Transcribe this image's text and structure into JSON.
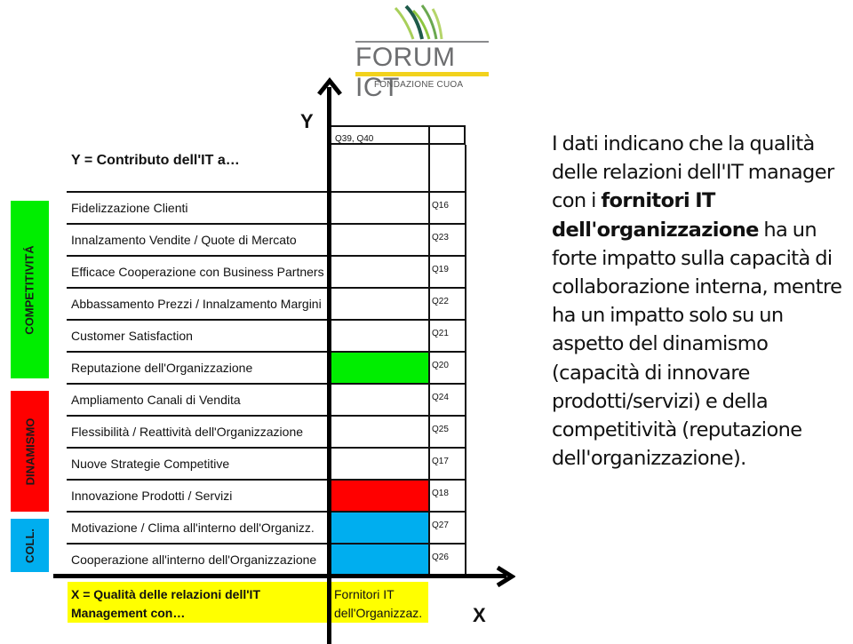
{
  "logo": {
    "name": "FORUM ICT",
    "subtitle": "FONDAZIONE CUOA",
    "colors": {
      "text": "#6d6e70",
      "accent": "#f2d21c",
      "grass_light": "#8dc63f",
      "grass_dark": "#1e5b4a"
    }
  },
  "categories": [
    {
      "label": "COMPETITIVITÁ",
      "color": "#00ee00"
    },
    {
      "label": "DINAMISMO",
      "color": "#ff0000"
    },
    {
      "label": "COLL.",
      "color": "#00aeef"
    }
  ],
  "y_axis": {
    "letter": "Y",
    "title": "Y = Contributo dell'IT a…",
    "top_cell": "Q39, Q40"
  },
  "rows": [
    {
      "label": "Fidelizzazione Clienti",
      "question": "Q16",
      "fill": null
    },
    {
      "label": "Innalzamento Vendite / Quote di Mercato",
      "question": "Q23",
      "fill": null
    },
    {
      "label": "Efficace Cooperazione con Business Partners",
      "question": "Q19",
      "fill": null
    },
    {
      "label": "Abbassamento Prezzi / Innalzamento Margini",
      "question": "Q22",
      "fill": null
    },
    {
      "label": "Customer Satisfaction",
      "question": "Q21",
      "fill": null
    },
    {
      "label": "Reputazione dell'Organizzazione",
      "question": "Q20",
      "fill": "#00ee00"
    },
    {
      "label": "Ampliamento Canali di Vendita",
      "question": "Q24",
      "fill": null
    },
    {
      "label": "Flessibilità / Reattività dell'Organizzazione",
      "question": "Q25",
      "fill": null
    },
    {
      "label": "Nuove Strategie Competitive",
      "question": "Q17",
      "fill": null
    },
    {
      "label": "Innovazione Prodotti / Servizi",
      "question": "Q18",
      "fill": "#ff0000"
    },
    {
      "label": "Motivazione / Clima all'interno dell'Organizz.",
      "question": "Q27",
      "fill": "#00aeef"
    },
    {
      "label": "Cooperazione all'interno dell'Organizzazione",
      "question": "Q26",
      "fill": "#00aeef"
    }
  ],
  "x_axis": {
    "letter": "X",
    "title": "X = Qualità delle relazioni dell'IT Management con…",
    "category": "Fornitori IT dell'Organizzaz.",
    "highlight_color": "#ffff00"
  },
  "paragraph": {
    "part1": "I dati indicano che la qualità delle relazioni dell'IT manager con i ",
    "bold": "fornitori IT dell'organizzazione",
    "part2": "  ha un forte impatto sulla capacità di collaborazione interna, mentre ha un impatto  solo su un aspetto del dinamismo (capacità di innovare prodotti/servizi) e della competitività (reputazione dell'organizzazione)."
  }
}
